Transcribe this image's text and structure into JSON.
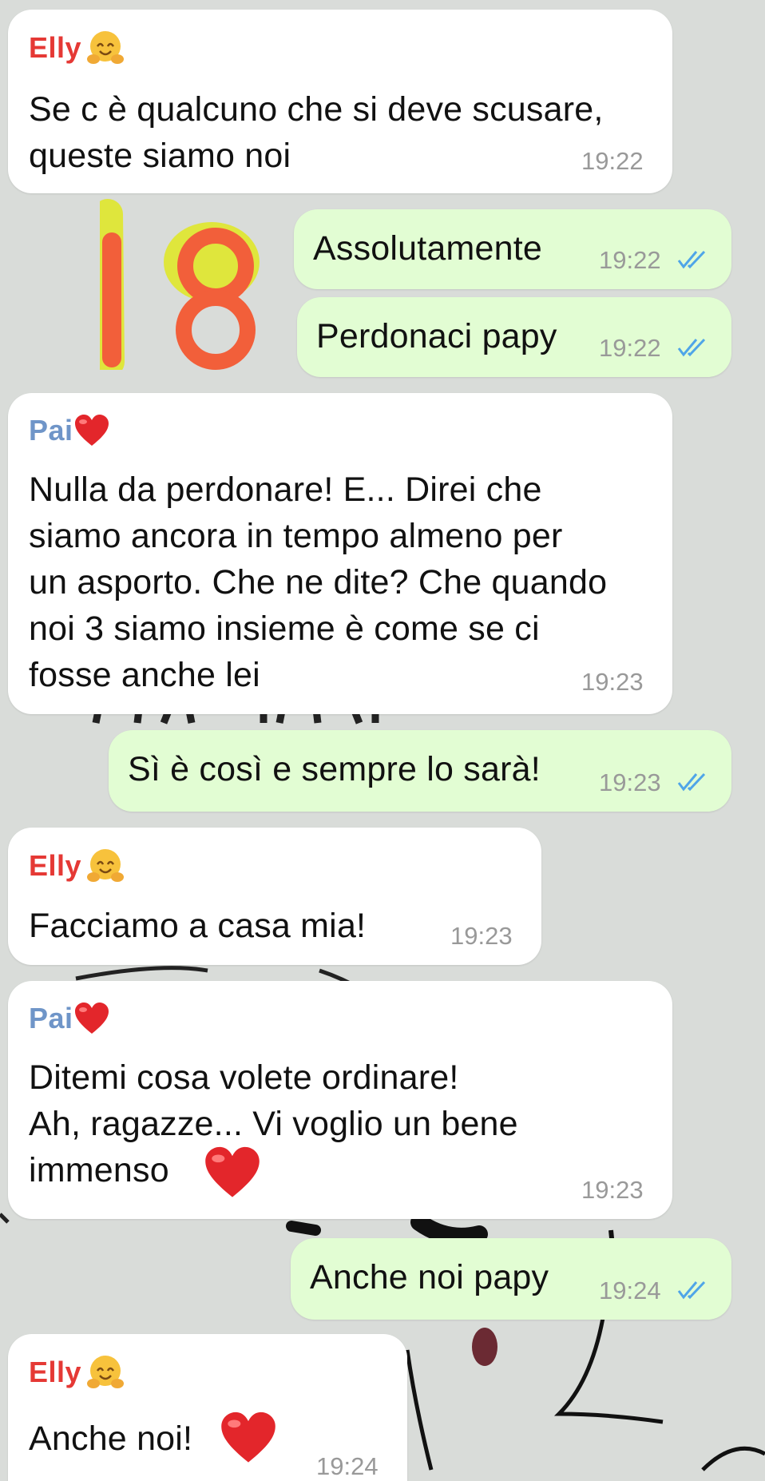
{
  "colors": {
    "elly": "#e53935",
    "pai": "#6f95c8",
    "incoming_bg": "#ffffff",
    "outgoing_bg": "#e2fdd3",
    "read_ticks": "#4fa5e8"
  },
  "sticker": {
    "text": "18"
  },
  "messages": [
    {
      "sender": "Elly",
      "sender_emoji": "hugging-face-icon",
      "text": "Se c è qualcuno che si deve scusare,\nqueste siamo noi",
      "time": "19:22"
    },
    {
      "sender": null,
      "text": "Assolutamente",
      "time": "19:22",
      "status": "read-double-check-icon"
    },
    {
      "sender": null,
      "text": "Perdonaci papy",
      "time": "19:22",
      "status": "read-double-check-icon"
    },
    {
      "sender": "Pai",
      "sender_emoji": "red-heart-icon",
      "text": "Nulla da perdonare! E... Direi che\nsiamo ancora in tempo almeno per\nun asporto. Che ne dite? Che quando\nnoi 3 siamo insieme è come se ci\nfosse anche lei",
      "time": "19:23"
    },
    {
      "sender": null,
      "text": "Sì è così e sempre lo sarà!",
      "time": "19:23",
      "status": "read-double-check-icon"
    },
    {
      "sender": "Elly",
      "sender_emoji": "hugging-face-icon",
      "text": "Facciamo a casa mia!",
      "time": "19:23"
    },
    {
      "sender": "Pai",
      "sender_emoji": "red-heart-icon",
      "text": "Ditemi cosa volete ordinare!\nAh, ragazze... Vi voglio un bene\nimmenso",
      "trailing_emoji": "red-heart-icon",
      "time": "19:23"
    },
    {
      "sender": null,
      "text": "Anche noi papy",
      "time": "19:24",
      "status": "read-double-check-icon"
    },
    {
      "sender": "Elly",
      "sender_emoji": "hugging-face-icon",
      "text": "Anche noi!",
      "trailing_emoji": "red-heart-icon",
      "time": "19:24"
    }
  ]
}
